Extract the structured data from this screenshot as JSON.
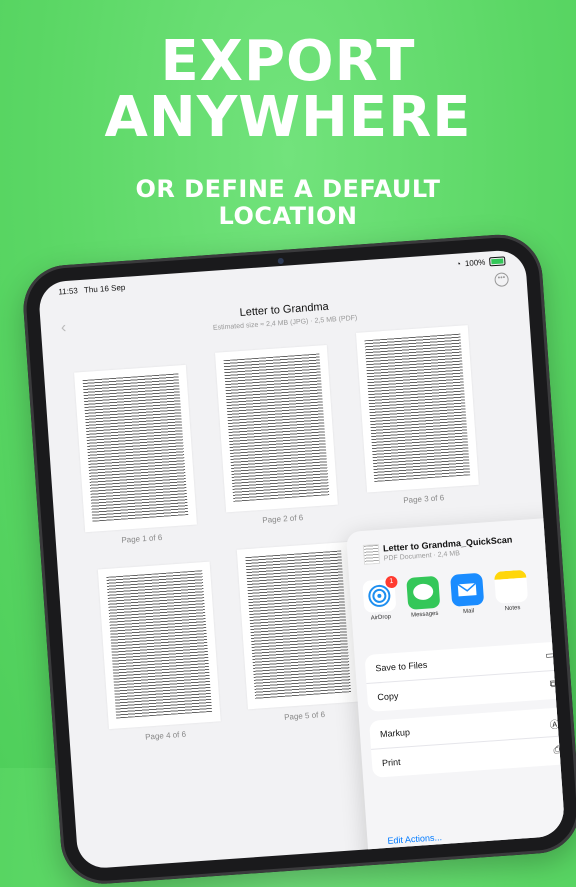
{
  "headline": {
    "line1": "EXPORT",
    "line2": "ANYWHERE"
  },
  "subheadline": {
    "line1": "OR DEFINE A DEFAULT",
    "line2": "LOCATION"
  },
  "status_bar": {
    "time": "11:53",
    "date": "Thu 16 Sep",
    "battery": "100%"
  },
  "document": {
    "title": "Letter to Grandma",
    "estimate": "Estimated size ≈ 2,4 MB (JPG) · 2,5 MB (PDF)",
    "pages": [
      "Page 1 of 6",
      "Page 2 of 6",
      "Page 3 of 6",
      "Page 4 of 6",
      "Page 5 of 6"
    ]
  },
  "share_sheet": {
    "file_name": "Letter to Grandma_QuickScan",
    "file_info": "PDF Document · 2,4 MB",
    "apps": [
      {
        "label": "AirDrop",
        "color": "#1e8ff0",
        "badge": "1"
      },
      {
        "label": "Messages",
        "color": "#34c759"
      },
      {
        "label": "Mail",
        "color": "#1a8cff"
      },
      {
        "label": "Notes",
        "color": "#ffd60a"
      }
    ],
    "actions_group1": [
      {
        "label": "Save to Files",
        "icon": "folder-icon"
      },
      {
        "label": "Copy",
        "icon": "copy-icon"
      }
    ],
    "actions_group2": [
      {
        "label": "Markup",
        "icon": "markup-icon"
      },
      {
        "label": "Print",
        "icon": "printer-icon"
      }
    ],
    "edit_actions": "Edit Actions..."
  }
}
